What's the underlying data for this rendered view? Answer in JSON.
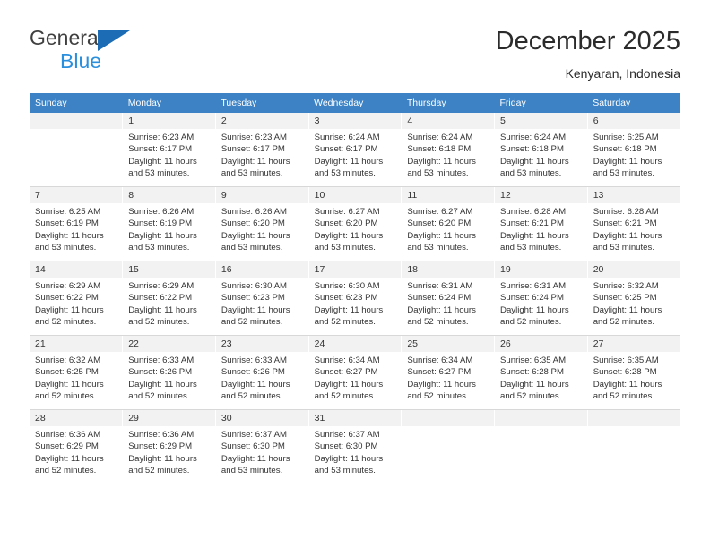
{
  "brand": {
    "name_part1": "General",
    "name_part2": "Blue",
    "logo_icon": "triangle-logo-icon"
  },
  "header": {
    "title": "December 2025",
    "subtitle": "Kenyaran, Indonesia"
  },
  "colors": {
    "header_row": "#3c82c4",
    "brand_blue_dark": "#1b6cb5",
    "brand_blue_light": "#2a8fdd",
    "daynum_bar": "#f2f2f2",
    "cell_border": "#d8d8d8",
    "text": "#333333"
  },
  "weekdays": [
    "Sunday",
    "Monday",
    "Tuesday",
    "Wednesday",
    "Thursday",
    "Friday",
    "Saturday"
  ],
  "weeks": [
    [
      {
        "day": "",
        "lines": []
      },
      {
        "day": "1",
        "lines": [
          "Sunrise: 6:23 AM",
          "Sunset: 6:17 PM",
          "Daylight: 11 hours",
          "and 53 minutes."
        ]
      },
      {
        "day": "2",
        "lines": [
          "Sunrise: 6:23 AM",
          "Sunset: 6:17 PM",
          "Daylight: 11 hours",
          "and 53 minutes."
        ]
      },
      {
        "day": "3",
        "lines": [
          "Sunrise: 6:24 AM",
          "Sunset: 6:17 PM",
          "Daylight: 11 hours",
          "and 53 minutes."
        ]
      },
      {
        "day": "4",
        "lines": [
          "Sunrise: 6:24 AM",
          "Sunset: 6:18 PM",
          "Daylight: 11 hours",
          "and 53 minutes."
        ]
      },
      {
        "day": "5",
        "lines": [
          "Sunrise: 6:24 AM",
          "Sunset: 6:18 PM",
          "Daylight: 11 hours",
          "and 53 minutes."
        ]
      },
      {
        "day": "6",
        "lines": [
          "Sunrise: 6:25 AM",
          "Sunset: 6:18 PM",
          "Daylight: 11 hours",
          "and 53 minutes."
        ]
      }
    ],
    [
      {
        "day": "7",
        "lines": [
          "Sunrise: 6:25 AM",
          "Sunset: 6:19 PM",
          "Daylight: 11 hours",
          "and 53 minutes."
        ]
      },
      {
        "day": "8",
        "lines": [
          "Sunrise: 6:26 AM",
          "Sunset: 6:19 PM",
          "Daylight: 11 hours",
          "and 53 minutes."
        ]
      },
      {
        "day": "9",
        "lines": [
          "Sunrise: 6:26 AM",
          "Sunset: 6:20 PM",
          "Daylight: 11 hours",
          "and 53 minutes."
        ]
      },
      {
        "day": "10",
        "lines": [
          "Sunrise: 6:27 AM",
          "Sunset: 6:20 PM",
          "Daylight: 11 hours",
          "and 53 minutes."
        ]
      },
      {
        "day": "11",
        "lines": [
          "Sunrise: 6:27 AM",
          "Sunset: 6:20 PM",
          "Daylight: 11 hours",
          "and 53 minutes."
        ]
      },
      {
        "day": "12",
        "lines": [
          "Sunrise: 6:28 AM",
          "Sunset: 6:21 PM",
          "Daylight: 11 hours",
          "and 53 minutes."
        ]
      },
      {
        "day": "13",
        "lines": [
          "Sunrise: 6:28 AM",
          "Sunset: 6:21 PM",
          "Daylight: 11 hours",
          "and 53 minutes."
        ]
      }
    ],
    [
      {
        "day": "14",
        "lines": [
          "Sunrise: 6:29 AM",
          "Sunset: 6:22 PM",
          "Daylight: 11 hours",
          "and 52 minutes."
        ]
      },
      {
        "day": "15",
        "lines": [
          "Sunrise: 6:29 AM",
          "Sunset: 6:22 PM",
          "Daylight: 11 hours",
          "and 52 minutes."
        ]
      },
      {
        "day": "16",
        "lines": [
          "Sunrise: 6:30 AM",
          "Sunset: 6:23 PM",
          "Daylight: 11 hours",
          "and 52 minutes."
        ]
      },
      {
        "day": "17",
        "lines": [
          "Sunrise: 6:30 AM",
          "Sunset: 6:23 PM",
          "Daylight: 11 hours",
          "and 52 minutes."
        ]
      },
      {
        "day": "18",
        "lines": [
          "Sunrise: 6:31 AM",
          "Sunset: 6:24 PM",
          "Daylight: 11 hours",
          "and 52 minutes."
        ]
      },
      {
        "day": "19",
        "lines": [
          "Sunrise: 6:31 AM",
          "Sunset: 6:24 PM",
          "Daylight: 11 hours",
          "and 52 minutes."
        ]
      },
      {
        "day": "20",
        "lines": [
          "Sunrise: 6:32 AM",
          "Sunset: 6:25 PM",
          "Daylight: 11 hours",
          "and 52 minutes."
        ]
      }
    ],
    [
      {
        "day": "21",
        "lines": [
          "Sunrise: 6:32 AM",
          "Sunset: 6:25 PM",
          "Daylight: 11 hours",
          "and 52 minutes."
        ]
      },
      {
        "day": "22",
        "lines": [
          "Sunrise: 6:33 AM",
          "Sunset: 6:26 PM",
          "Daylight: 11 hours",
          "and 52 minutes."
        ]
      },
      {
        "day": "23",
        "lines": [
          "Sunrise: 6:33 AM",
          "Sunset: 6:26 PM",
          "Daylight: 11 hours",
          "and 52 minutes."
        ]
      },
      {
        "day": "24",
        "lines": [
          "Sunrise: 6:34 AM",
          "Sunset: 6:27 PM",
          "Daylight: 11 hours",
          "and 52 minutes."
        ]
      },
      {
        "day": "25",
        "lines": [
          "Sunrise: 6:34 AM",
          "Sunset: 6:27 PM",
          "Daylight: 11 hours",
          "and 52 minutes."
        ]
      },
      {
        "day": "26",
        "lines": [
          "Sunrise: 6:35 AM",
          "Sunset: 6:28 PM",
          "Daylight: 11 hours",
          "and 52 minutes."
        ]
      },
      {
        "day": "27",
        "lines": [
          "Sunrise: 6:35 AM",
          "Sunset: 6:28 PM",
          "Daylight: 11 hours",
          "and 52 minutes."
        ]
      }
    ],
    [
      {
        "day": "28",
        "lines": [
          "Sunrise: 6:36 AM",
          "Sunset: 6:29 PM",
          "Daylight: 11 hours",
          "and 52 minutes."
        ]
      },
      {
        "day": "29",
        "lines": [
          "Sunrise: 6:36 AM",
          "Sunset: 6:29 PM",
          "Daylight: 11 hours",
          "and 52 minutes."
        ]
      },
      {
        "day": "30",
        "lines": [
          "Sunrise: 6:37 AM",
          "Sunset: 6:30 PM",
          "Daylight: 11 hours",
          "and 53 minutes."
        ]
      },
      {
        "day": "31",
        "lines": [
          "Sunrise: 6:37 AM",
          "Sunset: 6:30 PM",
          "Daylight: 11 hours",
          "and 53 minutes."
        ]
      },
      {
        "day": "",
        "lines": []
      },
      {
        "day": "",
        "lines": []
      },
      {
        "day": "",
        "lines": []
      }
    ]
  ]
}
